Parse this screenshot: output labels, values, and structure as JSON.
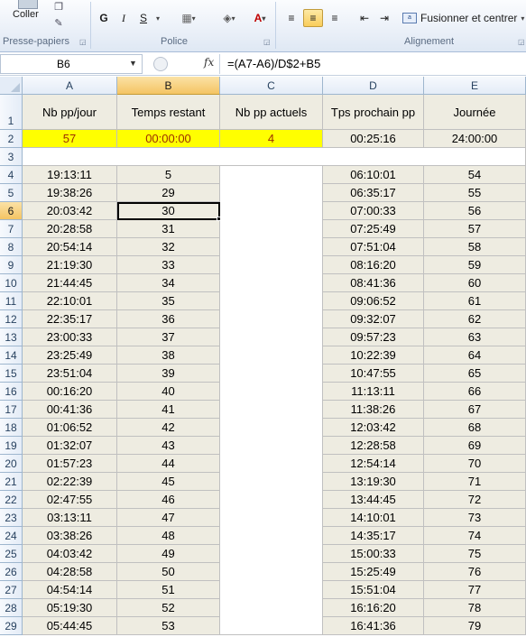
{
  "ribbon": {
    "paste_label": "Coller",
    "bold": "G",
    "italic": "I",
    "underline": "S",
    "merge_label": "Fusionner et centrer",
    "groups": [
      "Presse-papiers",
      "Police",
      "Alignement"
    ]
  },
  "formula_bar": {
    "name_box": "B6",
    "fx": "fx",
    "formula": "=(A7-A6)/D$2+B5"
  },
  "columns": [
    "A",
    "B",
    "C",
    "D",
    "E"
  ],
  "selected_column": "B",
  "selected_row": "6",
  "headers": [
    "Nb pp/jour",
    "Temps restant",
    "Nb pp actuels",
    "Tps prochain pp",
    "Journée"
  ],
  "row2": [
    "57",
    "00:00:00",
    "4",
    "00:25:16",
    "24:00:00"
  ],
  "row_numbers": [
    "1",
    "2",
    "3",
    "4",
    "5",
    "6",
    "7",
    "8",
    "9",
    "10",
    "11",
    "12",
    "13",
    "14",
    "15",
    "16",
    "17",
    "18",
    "19",
    "20",
    "21",
    "22",
    "23",
    "24",
    "25",
    "26",
    "27",
    "28",
    "29"
  ],
  "rows": [
    [
      "19:13:11",
      "5",
      "06:10:01",
      "54"
    ],
    [
      "19:38:26",
      "29",
      "06:35:17",
      "55"
    ],
    [
      "20:03:42",
      "30",
      "07:00:33",
      "56"
    ],
    [
      "20:28:58",
      "31",
      "07:25:49",
      "57"
    ],
    [
      "20:54:14",
      "32",
      "07:51:04",
      "58"
    ],
    [
      "21:19:30",
      "33",
      "08:16:20",
      "59"
    ],
    [
      "21:44:45",
      "34",
      "08:41:36",
      "60"
    ],
    [
      "22:10:01",
      "35",
      "09:06:52",
      "61"
    ],
    [
      "22:35:17",
      "36",
      "09:32:07",
      "62"
    ],
    [
      "23:00:33",
      "37",
      "09:57:23",
      "63"
    ],
    [
      "23:25:49",
      "38",
      "10:22:39",
      "64"
    ],
    [
      "23:51:04",
      "39",
      "10:47:55",
      "65"
    ],
    [
      "00:16:20",
      "40",
      "11:13:11",
      "66"
    ],
    [
      "00:41:36",
      "41",
      "11:38:26",
      "67"
    ],
    [
      "01:06:52",
      "42",
      "12:03:42",
      "68"
    ],
    [
      "01:32:07",
      "43",
      "12:28:58",
      "69"
    ],
    [
      "01:57:23",
      "44",
      "12:54:14",
      "70"
    ],
    [
      "02:22:39",
      "45",
      "13:19:30",
      "71"
    ],
    [
      "02:47:55",
      "46",
      "13:44:45",
      "72"
    ],
    [
      "03:13:11",
      "47",
      "14:10:01",
      "73"
    ],
    [
      "03:38:26",
      "48",
      "14:35:17",
      "74"
    ],
    [
      "04:03:42",
      "49",
      "15:00:33",
      "75"
    ],
    [
      "04:28:58",
      "50",
      "15:25:49",
      "76"
    ],
    [
      "04:54:14",
      "51",
      "15:51:04",
      "77"
    ],
    [
      "05:19:30",
      "52",
      "16:16:20",
      "78"
    ],
    [
      "05:44:45",
      "53",
      "16:41:36",
      "79"
    ]
  ],
  "colors": {
    "highlight": "#ffff00",
    "highlight_text": "#9c2e00",
    "cell_fill": "#eeece1",
    "selection_header": "#f4c463"
  }
}
